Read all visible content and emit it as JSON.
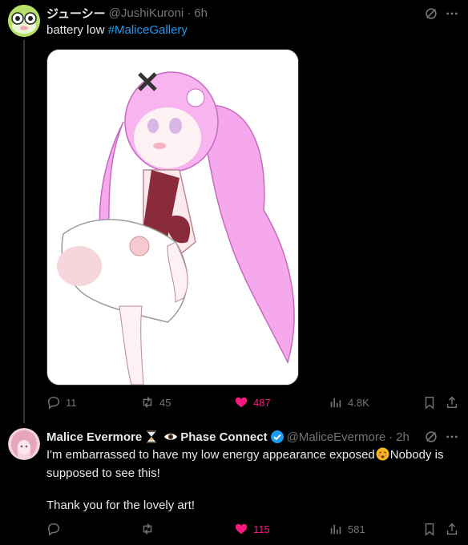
{
  "post1": {
    "display_name": "ジューシー",
    "handle": "@JushiKuroni",
    "separator": "·",
    "time": "6h",
    "text": "battery low ",
    "hashtag": "#MaliceGallery",
    "media_alt": "illustration of pink-haired character in white dress",
    "stats": {
      "replies": "11",
      "reposts": "45",
      "likes": "487",
      "views": "4.8K"
    }
  },
  "post2": {
    "display_name": "Malice Evermore",
    "badge_text": "Phase Connect",
    "handle": "@MaliceEvermore",
    "separator": "·",
    "time": "2h",
    "line1": "I'm embarrassed to have my low energy appearance exposed",
    "line1_after": "Nobody is",
    "line2": "supposed to see this!",
    "line3": "Thank you for the lovely art!",
    "stats": {
      "replies": "",
      "reposts": "",
      "likes": "115",
      "views": "581"
    }
  },
  "colors": {
    "accent": "#1d9bf0",
    "like": "#f91880",
    "muted": "#71767b",
    "text": "#e7e9ea"
  },
  "icons": [
    "grok-icon",
    "more-icon",
    "reply-icon",
    "repost-icon",
    "like-icon",
    "views-icon",
    "bookmark-icon",
    "share-icon",
    "verified-icon",
    "hourglass-icon",
    "eye-icon",
    "emoji-icon"
  ]
}
